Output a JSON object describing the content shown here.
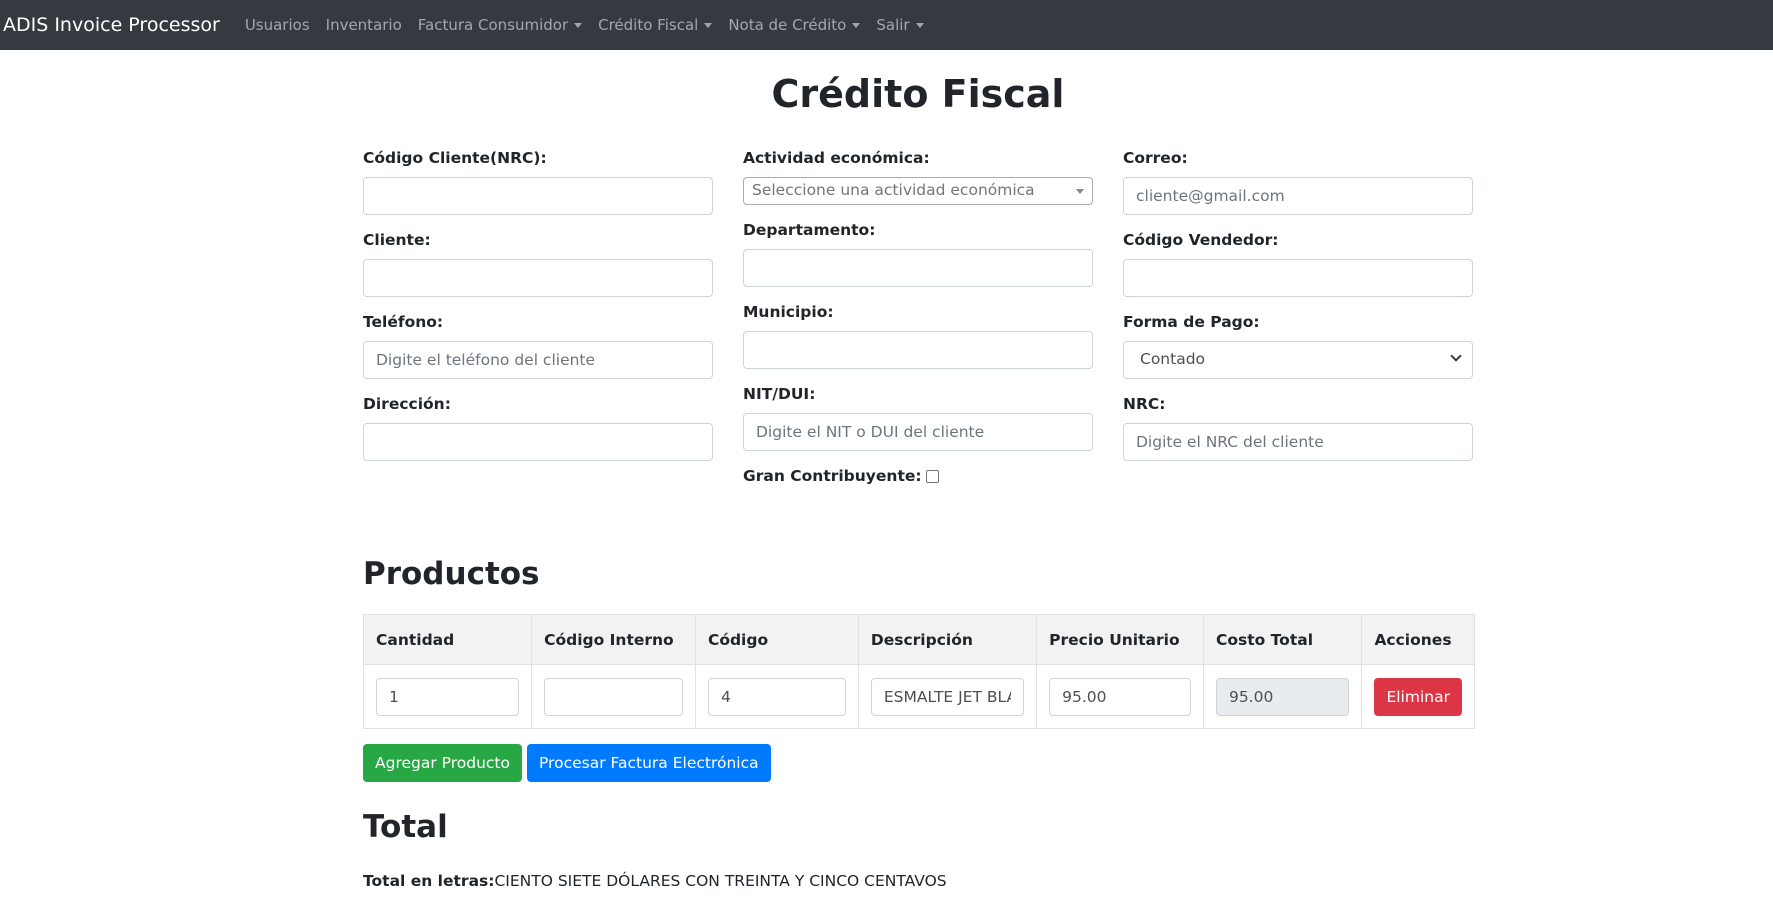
{
  "navbar": {
    "brand": "ADIS Invoice Processor",
    "items": [
      {
        "label": "Usuarios",
        "dropdown": false
      },
      {
        "label": "Inventario",
        "dropdown": false
      },
      {
        "label": "Factura Consumidor",
        "dropdown": true
      },
      {
        "label": "Crédito Fiscal",
        "dropdown": true
      },
      {
        "label": "Nota de Crédito",
        "dropdown": true
      },
      {
        "label": "Salir",
        "dropdown": true
      }
    ]
  },
  "page": {
    "title": "Crédito Fiscal"
  },
  "form": {
    "codigo_cliente": {
      "label": "Código Cliente(NRC):",
      "value": "",
      "placeholder": ""
    },
    "cliente": {
      "label": "Cliente:",
      "value": "",
      "placeholder": ""
    },
    "telefono": {
      "label": "Teléfono:",
      "value": "",
      "placeholder": "Digite el teléfono del cliente"
    },
    "direccion": {
      "label": "Dirección:",
      "value": "",
      "placeholder": ""
    },
    "actividad": {
      "label": "Actividad económica:",
      "placeholder": "Seleccione una actividad económica"
    },
    "departamento": {
      "label": "Departamento:",
      "value": "",
      "placeholder": ""
    },
    "municipio": {
      "label": "Municipio:",
      "value": "",
      "placeholder": ""
    },
    "nit_dui": {
      "label": "NIT/DUI:",
      "value": "",
      "placeholder": "Digite el NIT o DUI del cliente"
    },
    "gran_contribuyente": {
      "label": "Gran Contribuyente:",
      "checked": false
    },
    "correo": {
      "label": "Correo:",
      "value": "",
      "placeholder": "cliente@gmail.com"
    },
    "codigo_vendedor": {
      "label": "Código Vendedor:",
      "value": "",
      "placeholder": ""
    },
    "forma_pago": {
      "label": "Forma de Pago:",
      "selected": "Contado"
    },
    "nrc": {
      "label": "NRC:",
      "value": "",
      "placeholder": "Digite el NRC del cliente"
    }
  },
  "productos": {
    "title": "Productos",
    "columns": [
      "Cantidad",
      "Código Interno",
      "Código",
      "Descripción",
      "Precio Unitario",
      "Costo Total",
      "Acciones"
    ],
    "rows": [
      {
        "cantidad": "1",
        "codigo_interno": "",
        "codigo": "4",
        "descripcion": "ESMALTE JET BLAN",
        "precio_unitario": "95.00",
        "costo_total": "95.00",
        "accion": "Eliminar"
      }
    ],
    "add_button": "Agregar Producto",
    "process_button": "Procesar Factura Electrónica"
  },
  "total": {
    "title": "Total",
    "letras_label": "Total en letras:",
    "letras_value": "CIENTO SIETE DÓLARES CON TREINTA Y CINCO CENTAVOS"
  },
  "colors": {
    "navbar": "#343a40",
    "success": "#28a745",
    "primary": "#007bff",
    "danger": "#dc3545"
  }
}
